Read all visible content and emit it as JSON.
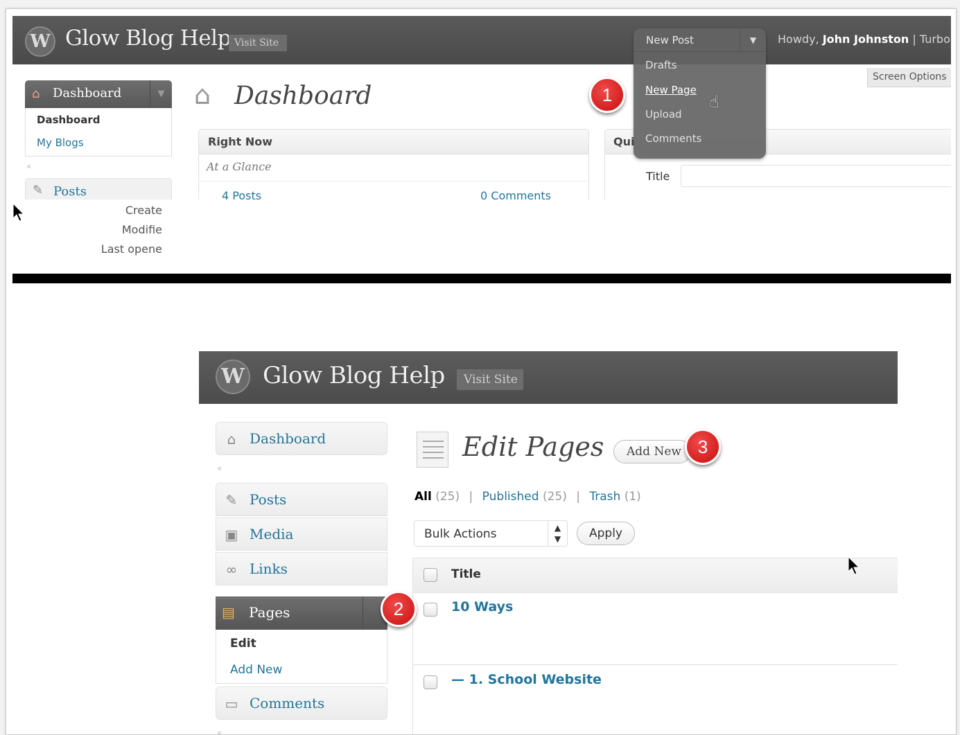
{
  "panel1": {
    "site_title": "Glow Blog Help",
    "visit_site": "Visit Site",
    "howdy_prefix": "Howdy, ",
    "user_name": "John Johnston",
    "howdy_trail": " | Turbo",
    "screen_options": "Screen Options",
    "new_post_menu": {
      "label": "New Post",
      "items": [
        "Drafts",
        "New Page",
        "Upload",
        "Comments"
      ]
    },
    "sidebar": {
      "dashboard": "Dashboard",
      "sub": [
        "Dashboard",
        "My Blogs"
      ],
      "posts": "Posts",
      "posts_meta": [
        "Create",
        "Modifie",
        "Last opene"
      ]
    },
    "page_title": "Dashboard",
    "right_now": {
      "title": "Right Now",
      "subtitle": "At a Glance",
      "posts": "4  Posts",
      "comments": "0  Comments"
    },
    "quick_press": {
      "title": "Qui",
      "title_label": "Title"
    }
  },
  "badges": [
    "1",
    "2",
    "3"
  ],
  "panel2": {
    "site_title": "Glow Blog Help",
    "visit_site": "Visit Site",
    "sidebar": {
      "dashboard": "Dashboard",
      "posts": "Posts",
      "media": "Media",
      "links": "Links",
      "pages": "Pages",
      "pages_sub": [
        "Edit",
        "Add New"
      ],
      "comments": "Comments"
    },
    "page_title": "Edit Pages",
    "add_new": "Add New",
    "filters": {
      "all": "All",
      "all_count": "(25)",
      "published": "Published",
      "published_count": "(25)",
      "trash": "Trash",
      "trash_count": "(1)"
    },
    "bulk_actions": "Bulk Actions",
    "apply": "Apply",
    "table": {
      "header": "Title",
      "rows": [
        "10 Ways",
        "— 1. School Website"
      ]
    }
  },
  "colors": {
    "link": "#21759b",
    "header_bg": "#4f4f4f",
    "badge_red": "#d41818"
  }
}
